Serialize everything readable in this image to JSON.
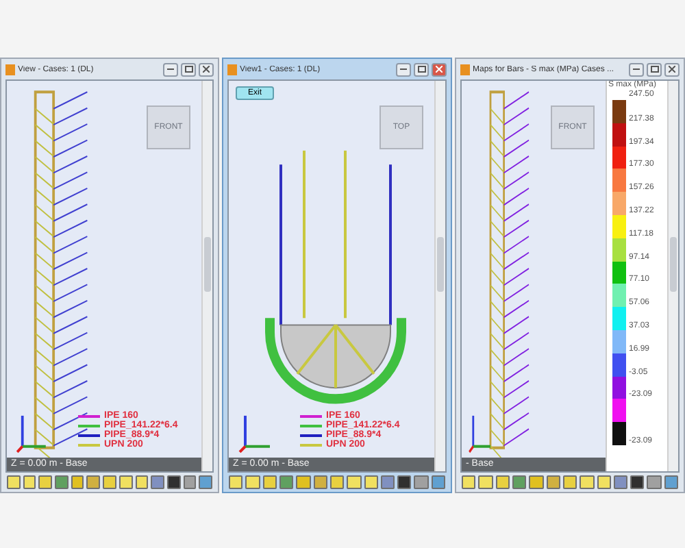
{
  "windows": [
    {
      "title": "View - Cases: 1 (DL)",
      "active": false,
      "kind": "elevation",
      "view_cube": "FRONT",
      "status": "Z = 0.00 m - Base",
      "legend": [
        {
          "name": "IPE 160",
          "color": "#d020d0"
        },
        {
          "name": "PIPE_141.22*6.4",
          "color": "#40c040"
        },
        {
          "name": "PIPE_88.9*4",
          "color": "#2020c0"
        },
        {
          "name": "UPN 200",
          "color": "#c8c840"
        }
      ]
    },
    {
      "title": "View1 - Cases: 1 (DL)",
      "active": true,
      "kind": "plan",
      "view_cube": "TOP",
      "exit_button": "Exit",
      "status": "Z = 0.00 m - Base",
      "legend": [
        {
          "name": "IPE 160",
          "color": "#d020d0"
        },
        {
          "name": "PIPE_141.22*6.4",
          "color": "#40c040"
        },
        {
          "name": "PIPE_88.9*4",
          "color": "#2020c0"
        },
        {
          "name": "UPN 200",
          "color": "#c8c840"
        }
      ]
    },
    {
      "title": "Maps for Bars - S max (MPa) Cases ...",
      "active": false,
      "kind": "map",
      "view_cube": "FRONT",
      "status": "- Base",
      "scale": {
        "title": "S max (MPa)",
        "top_label": "247.50",
        "bands": [
          {
            "color": "#7a3a10",
            "label": "217.38"
          },
          {
            "color": "#c01010",
            "label": "197.34"
          },
          {
            "color": "#f02010",
            "label": "177.30"
          },
          {
            "color": "#f87840",
            "label": "157.26"
          },
          {
            "color": "#f8a868",
            "label": "137.22"
          },
          {
            "color": "#f8f010",
            "label": "117.18"
          },
          {
            "color": "#a8e040",
            "label": "97.14"
          },
          {
            "color": "#10c010",
            "label": "77.10"
          },
          {
            "color": "#70f0b0",
            "label": "57.06"
          },
          {
            "color": "#10f0f0",
            "label": "37.03"
          },
          {
            "color": "#80b8f8",
            "label": "16.99"
          },
          {
            "color": "#4050f0",
            "label": "-3.05"
          },
          {
            "color": "#9010e0",
            "label": "-23.09"
          },
          {
            "color": "#f010f0"
          },
          {
            "color": "#101010",
            "label": "-23.09"
          }
        ]
      }
    }
  ]
}
